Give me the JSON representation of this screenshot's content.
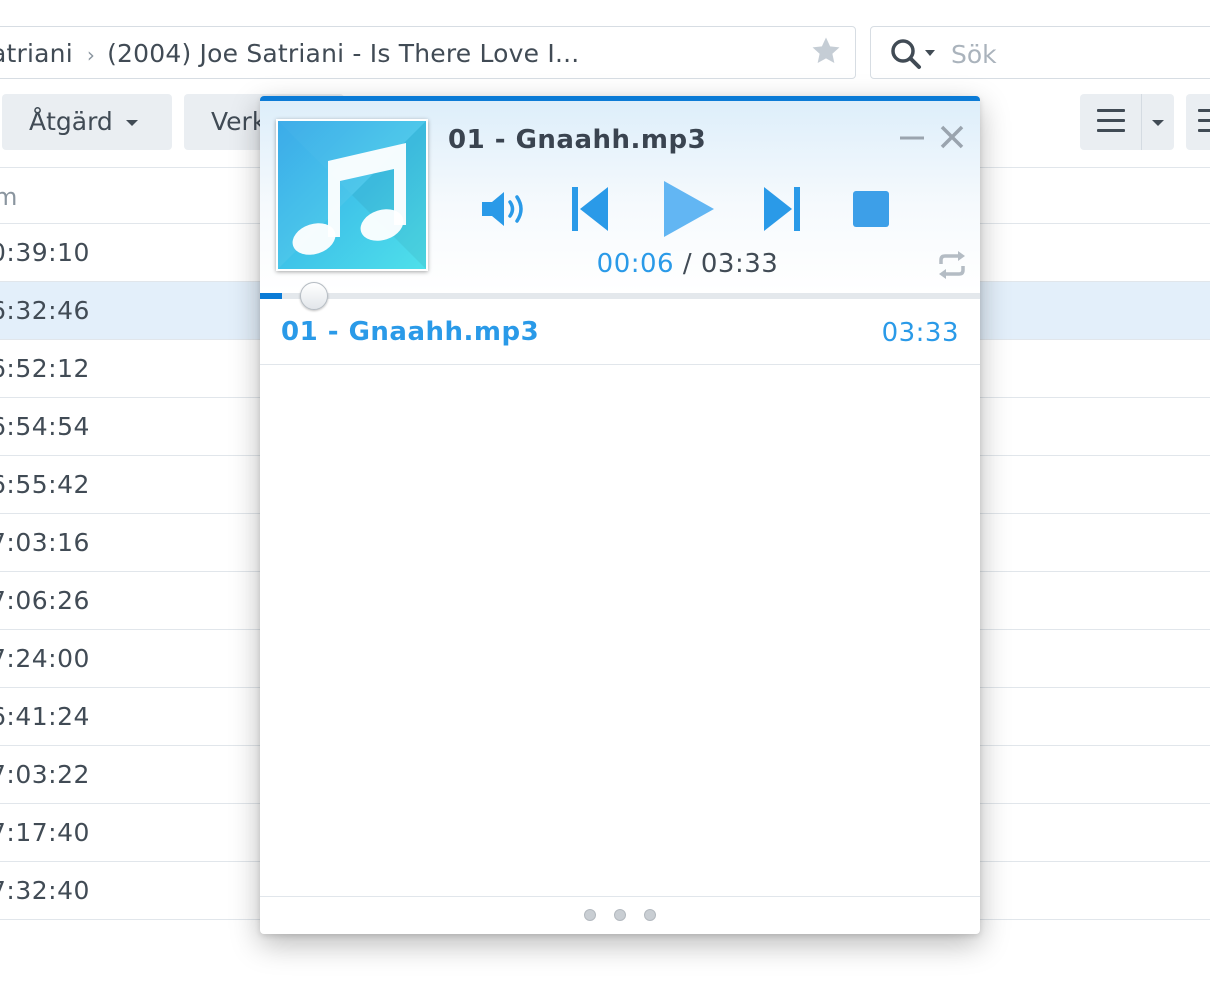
{
  "breadcrumb": {
    "segment_1": "atriani",
    "separator": "›",
    "segment_2": "(2004) Joe Satriani - Is There Love I..."
  },
  "search": {
    "placeholder": "Sök"
  },
  "toolbar": {
    "action_label": "Åtgärd",
    "tools_label": "Verk"
  },
  "file_list": {
    "column_header": "m",
    "rows": [
      {
        "time": "0:39:10",
        "selected": false
      },
      {
        "time": "6:32:46",
        "selected": true
      },
      {
        "time": "6:52:12",
        "selected": false
      },
      {
        "time": "6:54:54",
        "selected": false
      },
      {
        "time": "6:55:42",
        "selected": false
      },
      {
        "time": "7:03:16",
        "selected": false
      },
      {
        "time": "7:06:26",
        "selected": false
      },
      {
        "time": "7:24:00",
        "selected": false
      },
      {
        "time": "6:41:24",
        "selected": false
      },
      {
        "time": "7:03:22",
        "selected": false
      },
      {
        "time": "7:17:40",
        "selected": false
      },
      {
        "time": "7:32:40",
        "selected": false
      }
    ]
  },
  "player": {
    "title": "01 - Gnaahh.mp3",
    "current_time": "00:06",
    "time_separator": "/",
    "total_time": "03:33",
    "progress": 0.03,
    "icons": {
      "album_art": "music-note-icon",
      "volume": "volume-icon",
      "previous": "skip-previous-icon",
      "play": "play-icon",
      "next": "skip-next-icon",
      "stop": "stop-icon",
      "repeat": "repeat-icon",
      "minimize": "minimize-icon",
      "close": "close-icon"
    },
    "playlist": [
      {
        "name": "01 - Gnaahh.mp3",
        "duration": "03:33",
        "active": true
      }
    ]
  },
  "colors": {
    "accent_blue": "#2a9ae8",
    "top_bar": "#0b7bd6",
    "selected_row": "#e3effa"
  }
}
